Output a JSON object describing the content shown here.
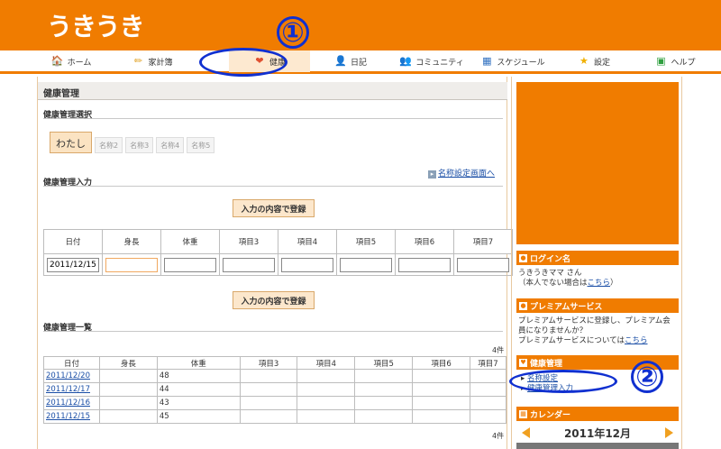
{
  "app": {
    "logo": "うきうき"
  },
  "nav": [
    {
      "label": "ホーム",
      "icon": "home-icon",
      "glyph": "🏠"
    },
    {
      "label": "家計簿",
      "icon": "pencil-icon",
      "glyph": "✏"
    },
    {
      "label": "健康",
      "icon": "heart-icon",
      "glyph": "❤"
    },
    {
      "label": "日記",
      "icon": "person-icon",
      "glyph": "👤"
    },
    {
      "label": "コミュニティ",
      "icon": "community-icon",
      "glyph": "👥"
    },
    {
      "label": "スケジュール",
      "icon": "calendar-icon",
      "glyph": "▦"
    },
    {
      "label": "設定",
      "icon": "star-icon",
      "glyph": "★"
    },
    {
      "label": "ヘルプ",
      "icon": "help-icon",
      "glyph": "▣"
    }
  ],
  "main": {
    "title": "健康管理",
    "select_title": "健康管理選択",
    "profiles": [
      "わたし",
      "名称2",
      "名称3",
      "名称4",
      "名称5"
    ],
    "settings_link": "名称設定画面へ",
    "input_title": "健康管理入力",
    "submit_label": "入力の内容で登録",
    "columns": [
      "日付",
      "身長",
      "体重",
      "項目3",
      "項目4",
      "項目5",
      "項目6",
      "項目7"
    ],
    "entry": {
      "date": "2011/12/15"
    },
    "list_title": "健康管理一覧",
    "count": "4件",
    "rows": [
      {
        "date": "2011/12/20",
        "height": "",
        "weight": "48"
      },
      {
        "date": "2011/12/17",
        "height": "",
        "weight": "44"
      },
      {
        "date": "2011/12/16",
        "height": "",
        "weight": "43"
      },
      {
        "date": "2011/12/15",
        "height": "",
        "weight": "45"
      }
    ]
  },
  "side": {
    "login": {
      "title": "ログイン名",
      "line1": "うきうきママ さん",
      "line2_pre": "（本人でない場合は",
      "line2_link": "こちら",
      "line2_post": "）"
    },
    "premium": {
      "title": "プレミアムサービス",
      "line1": "プレミアムサービスに登録し、プレミアム会",
      "line2": "員になりませんか？",
      "line3_pre": "プレミアムサービスについては",
      "line3_link": "こちら"
    },
    "health": {
      "title": "健康管理",
      "links": [
        "名称設定",
        "健康管理入力"
      ]
    },
    "calendar": {
      "title": "カレンダー",
      "month": "2011年12月"
    }
  },
  "annotations": [
    "①",
    "②"
  ],
  "colors": {
    "brand": "#f07c00",
    "annotation": "#1030d0"
  }
}
